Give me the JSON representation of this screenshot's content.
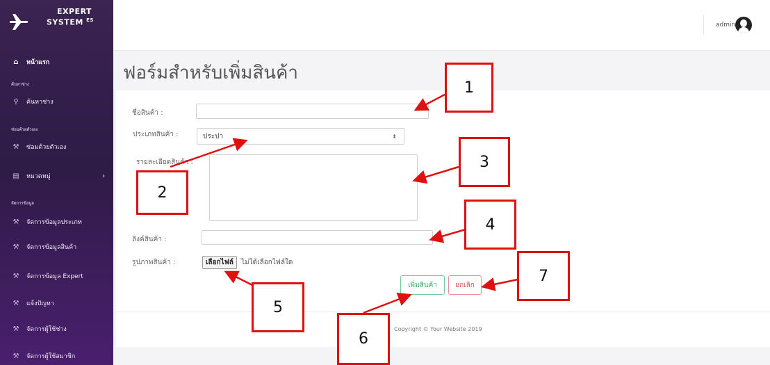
{
  "brand": {
    "line1": "EXPERT",
    "line2": "SYSTEM",
    "sup": "ES"
  },
  "sidebar": {
    "home": "หน้าแรก",
    "section_search": "ค้นหาช่าง",
    "search_item": "ค้นหาช่าง",
    "section_diy": "ซ่อมด้วยตัวเอง",
    "diy_item": "ซ่อมด้วยตัวเอง",
    "category_item": "หมวดหมู่",
    "section_manage": "จัดการข้อมูล",
    "items": [
      "จัดการข้อมูลประเภท",
      "จัดการข้อมูลสินค้า",
      "จัดการข้อมูล Expert",
      "แจ้งปัญหา",
      "จัดการผู้ใช้ช่าง",
      "จัดการผู้ใช้สมาชิก"
    ]
  },
  "topbar": {
    "user": "admin"
  },
  "page": {
    "title": "ฟอร์มสำหรับเพิ่มสินค้า"
  },
  "form": {
    "name_label": "ชื่อสินค้า :",
    "name_value": "",
    "type_label": "ประเภทสินค้า :",
    "type_selected": "ประปา",
    "detail_label": "รายละเอียดสินค้า :",
    "link_label": "ลิงค์สินค้า :",
    "link_value": "",
    "image_label": "รูปภาพสินค้า :",
    "file_button": "เลือกไฟล์",
    "file_none": "ไม่ได้เลือกไฟล์ใด",
    "add_button": "เพิ่มสินค้า",
    "cancel_button": "ยกเลิก"
  },
  "footer": {
    "text": "Copyright © Your Website 2019"
  },
  "annotations": [
    "1",
    "2",
    "3",
    "4",
    "5",
    "6",
    "7"
  ],
  "colors": {
    "sidebar": "#3b2352",
    "callout_border": "#e01010",
    "add_green": "#3cab6b",
    "cancel_red": "#e04848"
  }
}
